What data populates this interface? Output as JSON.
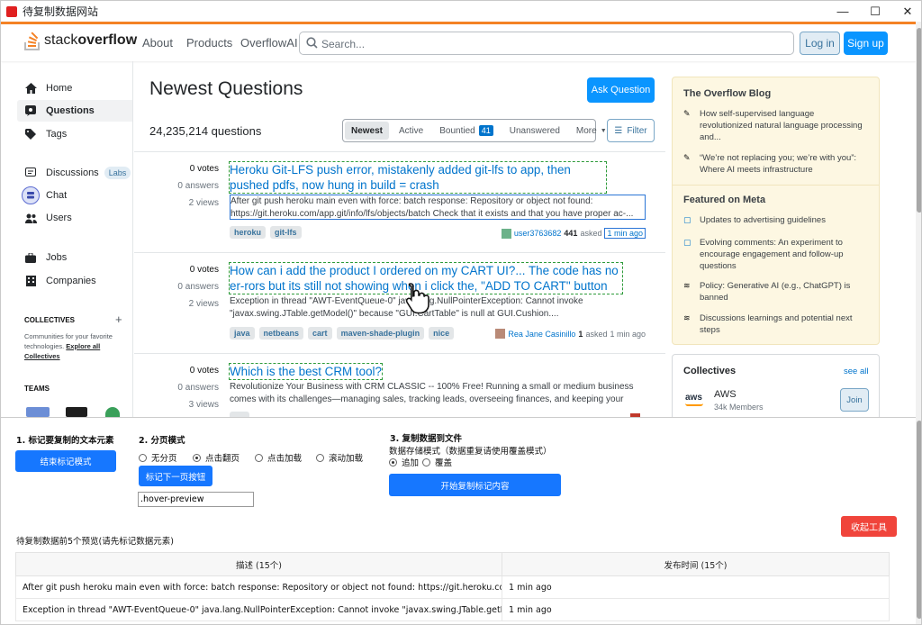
{
  "window": {
    "title": "待复制数据网站",
    "minimize": "—",
    "maximize": "☐",
    "close": "✕"
  },
  "header": {
    "logo_text_light": "stack",
    "logo_text_bold": "overflow",
    "nav": [
      "About",
      "Products",
      "OverflowAI"
    ],
    "search_placeholder": "Search...",
    "login": "Log in",
    "signup": "Sign up"
  },
  "sidebar": {
    "items": [
      {
        "label": "Home",
        "icon": "home-icon"
      },
      {
        "label": "Questions",
        "icon": "questions-icon",
        "active": true
      },
      {
        "label": "Tags",
        "icon": "tag-icon"
      },
      {
        "label": "Discussions",
        "icon": "discussions-icon",
        "badge": "Labs"
      },
      {
        "label": "Chat",
        "icon": "chat-icon"
      },
      {
        "label": "Users",
        "icon": "users-icon"
      },
      {
        "label": "Jobs",
        "icon": "jobs-icon"
      },
      {
        "label": "Companies",
        "icon": "companies-icon"
      }
    ],
    "collectives_header": "COLLECTIVES",
    "collectives_text": "Communities for your favorite technologies.",
    "explore_link": "Explore all Collectives",
    "teams_header": "TEAMS"
  },
  "main": {
    "title": "Newest Questions",
    "ask_button": "Ask Question",
    "count": "24,235,214 questions",
    "filters": [
      "Newest",
      "Active",
      "Bountied",
      "Unanswered",
      "More"
    ],
    "bountied_count": "41",
    "filter_button": "Filter",
    "questions": [
      {
        "votes": "0 votes",
        "answers": "0 answers",
        "views": "2 views",
        "title": "Heroku Git-LFS push error, mistakenly added git-lfs to app, then pushed pdfs, now hung in build = crash",
        "excerpt": "After git push heroku main even with force: batch response: Repository or object not found: https://git.heroku.com/app.git/info/lfs/objects/batch Check that it exists and that you have proper ac-...",
        "tags": [
          "heroku",
          "git-lfs"
        ],
        "user": "user3763682",
        "rep": "441",
        "asked": "asked",
        "time": "1 min ago"
      },
      {
        "votes": "0 votes",
        "answers": "0 answers",
        "views": "2 views",
        "title": "How can i add the product I ordered on my CART UI?... The code has no er-rors but its still not showing when i click the, \"ADD TO CART\" button",
        "excerpt": "Exception in thread \"AWT-EventQueue-0\" java.lang.NullPointerException: Cannot invoke \"javax.swing.JTable.getModel()\" because \"GUI.CartTable\" is null at GUI.Cushion....",
        "tags": [
          "java",
          "netbeans",
          "cart",
          "maven-shade-plugin",
          "nice"
        ],
        "user": "Rea Jane Casinillo",
        "rep": "1",
        "asked": "asked",
        "time": "1 min ago"
      },
      {
        "votes": "0 votes",
        "answers": "0 answers",
        "views": "3 views",
        "title": "Which is the best CRM tool?",
        "excerpt": "Revolutionize Your Business with CRM CLASSIC -- 100% Free! Running a small or medium business comes with its challenges—managing sales, tracking leads, overseeing finances, and keeping your tea...",
        "tags": [],
        "user": "",
        "rep": "",
        "asked": "",
        "time": ""
      }
    ]
  },
  "right": {
    "blog_header": "The Overflow Blog",
    "blog_items": [
      "How self-supervised language revolutionized natural language processing and...",
      "“We’re not replacing you; we’re with you”: Where AI meets infrastructure"
    ],
    "meta_header": "Featured on Meta",
    "meta_items": [
      "Updates to advertising guidelines",
      "Evolving comments: An experiment to encourage engagement and follow-up questions",
      "Policy: Generative AI (e.g., ChatGPT) is banned",
      "Discussions learnings and potential next steps"
    ],
    "collectives_header": "Collectives",
    "see_all": "see all",
    "collective_logo": "aws",
    "collective_name": "AWS",
    "collective_members": "34k Members",
    "join": "Join"
  },
  "tool": {
    "step1": "1. 标记要复制的文本元素",
    "end_mark": "结束标记模式",
    "step2": "2. 分页模式",
    "paging_options": [
      "无分页",
      "点击翻页",
      "点击加载",
      "滚动加载"
    ],
    "paging_selected": "点击翻页",
    "mark_next": "标记下一页按钮",
    "selector_value": ".hover-preview",
    "step3": "3. 复制数据到文件",
    "storage_mode": "数据存储模式（数据重复请使用覆盖模式）",
    "storage_options": [
      "追加",
      "覆盖"
    ],
    "storage_selected": "追加",
    "start_copy": "开始复制标记内容",
    "collapse": "收起工具",
    "preview_label": "待复制数据前5个预览(请先标记数据元素)",
    "table_headers": [
      "描述 (15个)",
      "发布时间 (15个)"
    ],
    "table_rows": [
      [
        "After git push heroku main even with force: batch response: Repository or object not found: https://git.heroku.com/app.git/info/lfs/objects/batch",
        "1 min ago"
      ],
      [
        "Exception in thread \"AWT-EventQueue-0\" java.lang.NullPointerException: Cannot invoke \"javax.swing.JTable.getModel()\" because",
        "1 min ago"
      ]
    ]
  },
  "colors": {
    "accent": "#f48225",
    "link": "#0074cc",
    "primary": "#0a95ff",
    "tool_blue": "#1677ff",
    "danger": "#f0443b"
  }
}
